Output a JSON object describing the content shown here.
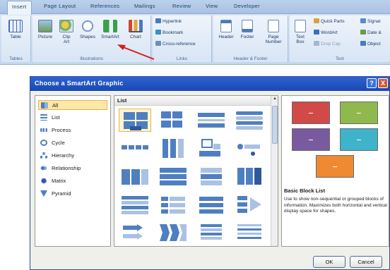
{
  "ribbon": {
    "tabs": [
      "Insert",
      "Page Layout",
      "References",
      "Mailings",
      "Review",
      "View",
      "Developer"
    ],
    "buttons": {
      "table": "Table",
      "picture": "Picture",
      "clip_art_1": "Clip",
      "clip_art_2": "Art",
      "shapes": "Shapes",
      "smartart": "SmartArt",
      "chart": "Chart",
      "header": "Header",
      "footer": "Footer",
      "page_number_1": "Page",
      "page_number_2": "Number",
      "text_box_1": "Text",
      "text_box_2": "Box"
    },
    "links": {
      "hyperlink": "Hyperlink",
      "bookmark": "Bookmark",
      "cross_reference": "Cross-reference"
    },
    "text_items": {
      "quick_parts": "Quick Parts",
      "wordart": "WordArt",
      "drop_cap": "Drop Cap",
      "signature": "Signat",
      "date_time": "Date &",
      "object": "Object"
    },
    "groups": {
      "tables": "Tables",
      "illustrations": "Illustrations",
      "links": "Links",
      "header_footer": "Header & Footer",
      "text": "Text"
    }
  },
  "dialog": {
    "title": "Choose a SmartArt Graphic",
    "help_glyph": "?",
    "close_glyph": "X",
    "categories": [
      "All",
      "List",
      "Process",
      "Cycle",
      "Hierarchy",
      "Relationship",
      "Matrix",
      "Pyramid"
    ],
    "selected_category": "All",
    "gallery_header": "List",
    "scroll_up_glyph": "▲",
    "preview": {
      "name": "Basic Block List",
      "description": "Use to show non-sequential or grouped blocks of information. Maximizes both horizontal and vertical display space for shapes."
    },
    "ok_label": "OK",
    "cancel_label": "Cancel"
  },
  "colors": {
    "titlebar": "#1a48b3",
    "selection": "#ffe7a8",
    "thumb_blue": "#4f7fc0",
    "preview_red": "#d14a47",
    "preview_green": "#8fb84e",
    "preview_purple": "#7a5a9e",
    "preview_cyan": "#3fb3c9",
    "preview_orange": "#f08a32",
    "arrow": "#d41c1c"
  }
}
